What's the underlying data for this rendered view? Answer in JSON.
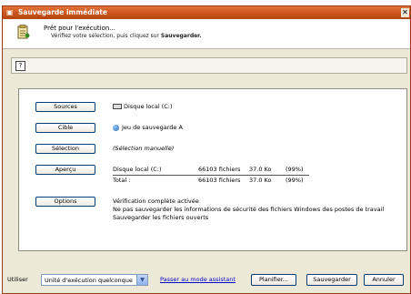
{
  "window": {
    "title": "Sauvegarde immédiate",
    "close_label": "✕"
  },
  "header": {
    "line1": "Prêt pour l'exécution...",
    "line2_prefix": "Vérifiez votre sélection, puis cliquez sur ",
    "line2_bold": "Sauvegarder."
  },
  "help_label": "?",
  "panel": {
    "sources": {
      "button": "Sources",
      "value": "Disque local (C:)"
    },
    "cible": {
      "button": "Cible",
      "value": "Jeu de sauvegarde A"
    },
    "selection": {
      "button": "Sélection",
      "value": "(Sélection manuelle)"
    },
    "apercu": {
      "button": "Aperçu",
      "rows": [
        {
          "name": "Disque local (C:)",
          "files": "66103 fichiers",
          "size": "37.0 Ko",
          "pct": "(99%)"
        },
        {
          "name": "Total :",
          "files": "66103 fichiers",
          "size": "37.0 Ko",
          "pct": "(99%)"
        }
      ]
    },
    "options": {
      "button": "Options",
      "lines": [
        "Vérification complète activée",
        "Ne pas sauvegarder les informations de sécurité des fichiers Windows des postes de travail",
        "Sauvegarder les fichiers ouverts"
      ]
    }
  },
  "footer": {
    "utiliser_label": "Utiliser",
    "combo_value": "Unité d'exécution quelconque",
    "link": "Passer au mode assistant",
    "planifier": "Planifier...",
    "sauvegarder": "Sauvegarder",
    "annuler": "Annuler"
  }
}
